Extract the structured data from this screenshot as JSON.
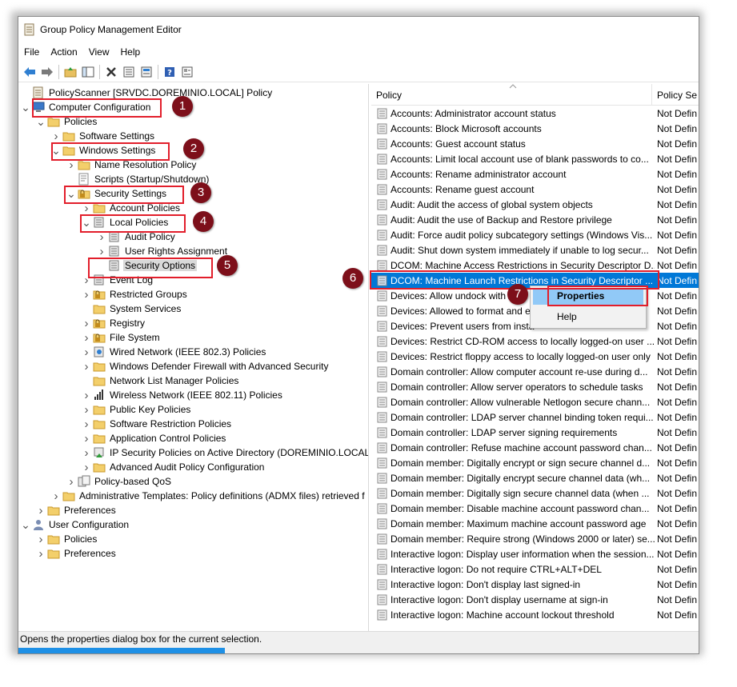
{
  "window": {
    "title": "Group Policy Management Editor"
  },
  "menu": [
    "File",
    "Action",
    "View",
    "Help"
  ],
  "toolbar": [
    "back-arrow-icon",
    "forward-arrow-icon",
    "up-folder-icon",
    "show-hide-tree-icon",
    "delete-icon",
    "properties-icon",
    "export-list-icon",
    "help-icon",
    "view-icon"
  ],
  "tree": [
    {
      "label": "PolicyScanner [SRVDC.DOREMINIO.LOCAL] Policy",
      "depth": 0,
      "arrow": "",
      "icon": "policy-scroll-icon"
    },
    {
      "label": "Computer Configuration",
      "depth": 0,
      "arrow": "down",
      "icon": "computer-icon"
    },
    {
      "label": "Policies",
      "depth": 1,
      "arrow": "down",
      "icon": "folder-icon"
    },
    {
      "label": "Software Settings",
      "depth": 2,
      "arrow": "right",
      "icon": "folder-icon"
    },
    {
      "label": "Windows Settings",
      "depth": 2,
      "arrow": "down",
      "icon": "folder-icon"
    },
    {
      "label": "Name Resolution Policy",
      "depth": 3,
      "arrow": "right",
      "icon": "folder-icon"
    },
    {
      "label": "Scripts (Startup/Shutdown)",
      "depth": 3,
      "arrow": "",
      "icon": "script-icon"
    },
    {
      "label": "Security Settings",
      "depth": 3,
      "arrow": "down",
      "icon": "lock-folder-icon"
    },
    {
      "label": "Account Policies",
      "depth": 4,
      "arrow": "right",
      "icon": "folder-icon"
    },
    {
      "label": "Local Policies",
      "depth": 4,
      "arrow": "down",
      "icon": "policy-book-icon"
    },
    {
      "label": "Audit Policy",
      "depth": 5,
      "arrow": "right",
      "icon": "policy-book-icon"
    },
    {
      "label": "User Rights Assignment",
      "depth": 5,
      "arrow": "right",
      "icon": "policy-book-icon"
    },
    {
      "label": "Security Options",
      "depth": 5,
      "arrow": "",
      "icon": "policy-book-icon",
      "selected": true
    },
    {
      "label": "Event Log",
      "depth": 4,
      "arrow": "right",
      "icon": "policy-book-icon"
    },
    {
      "label": "Restricted Groups",
      "depth": 4,
      "arrow": "right",
      "icon": "lock-folder-icon"
    },
    {
      "label": "System Services",
      "depth": 4,
      "arrow": "",
      "icon": "folder-icon"
    },
    {
      "label": "Registry",
      "depth": 4,
      "arrow": "right",
      "icon": "lock-folder-icon"
    },
    {
      "label": "File System",
      "depth": 4,
      "arrow": "right",
      "icon": "lock-folder-icon"
    },
    {
      "label": "Wired Network (IEEE 802.3) Policies",
      "depth": 4,
      "arrow": "right",
      "icon": "network-icon"
    },
    {
      "label": "Windows Defender Firewall with Advanced Security",
      "depth": 4,
      "arrow": "right",
      "icon": "folder-icon"
    },
    {
      "label": "Network List Manager Policies",
      "depth": 4,
      "arrow": "",
      "icon": "folder-icon"
    },
    {
      "label": "Wireless Network (IEEE 802.11) Policies",
      "depth": 4,
      "arrow": "right",
      "icon": "signal-icon"
    },
    {
      "label": "Public Key Policies",
      "depth": 4,
      "arrow": "right",
      "icon": "folder-icon"
    },
    {
      "label": "Software Restriction Policies",
      "depth": 4,
      "arrow": "right",
      "icon": "folder-icon"
    },
    {
      "label": "Application Control Policies",
      "depth": 4,
      "arrow": "right",
      "icon": "folder-icon"
    },
    {
      "label": "IP Security Policies on Active Directory (DOREMINIO.LOCAL)",
      "depth": 4,
      "arrow": "right",
      "icon": "ipsec-icon"
    },
    {
      "label": "Advanced Audit Policy Configuration",
      "depth": 4,
      "arrow": "right",
      "icon": "folder-icon"
    },
    {
      "label": "Policy-based QoS",
      "depth": 3,
      "arrow": "right",
      "icon": "qos-icon"
    },
    {
      "label": "Administrative Templates: Policy definitions (ADMX files) retrieved f",
      "depth": 2,
      "arrow": "right",
      "icon": "folder-icon"
    },
    {
      "label": "Preferences",
      "depth": 1,
      "arrow": "right",
      "icon": "folder-icon"
    },
    {
      "label": "User Configuration",
      "depth": 0,
      "arrow": "down",
      "icon": "user-icon"
    },
    {
      "label": "Policies",
      "depth": 1,
      "arrow": "right",
      "icon": "folder-icon"
    },
    {
      "label": "Preferences",
      "depth": 1,
      "arrow": "right",
      "icon": "folder-icon"
    }
  ],
  "list": {
    "columns": [
      "Policy",
      "Policy Se"
    ],
    "rows": [
      {
        "name": "Accounts: Administrator account status",
        "setting": "Not Defin"
      },
      {
        "name": "Accounts: Block Microsoft accounts",
        "setting": "Not Defin"
      },
      {
        "name": "Accounts: Guest account status",
        "setting": "Not Defin"
      },
      {
        "name": "Accounts: Limit local account use of blank passwords to co...",
        "setting": "Not Defin"
      },
      {
        "name": "Accounts: Rename administrator account",
        "setting": "Not Defin"
      },
      {
        "name": "Accounts: Rename guest account",
        "setting": "Not Defin"
      },
      {
        "name": "Audit: Audit the access of global system objects",
        "setting": "Not Defin"
      },
      {
        "name": "Audit: Audit the use of Backup and Restore privilege",
        "setting": "Not Defin"
      },
      {
        "name": "Audit: Force audit policy subcategory settings (Windows Vis...",
        "setting": "Not Defin"
      },
      {
        "name": "Audit: Shut down system immediately if unable to log secur...",
        "setting": "Not Defin"
      },
      {
        "name": "DCOM: Machine Access Restrictions in Security Descriptor D...",
        "setting": "Not Defin"
      },
      {
        "name": "DCOM: Machine Launch Restrictions in Security Descriptor ...",
        "setting": "Not Defin",
        "selected": true
      },
      {
        "name": "Devices: Allow undock with",
        "setting": "Not Defin"
      },
      {
        "name": "Devices: Allowed to format and e",
        "setting": "Not Defin"
      },
      {
        "name": "Devices: Prevent users from insta",
        "setting": "Not Defin"
      },
      {
        "name": "Devices: Restrict CD-ROM access to locally logged-on user ...",
        "setting": "Not Defin"
      },
      {
        "name": "Devices: Restrict floppy access to locally logged-on user only",
        "setting": "Not Defin"
      },
      {
        "name": "Domain controller: Allow computer account re-use during d...",
        "setting": "Not Defin"
      },
      {
        "name": "Domain controller: Allow server operators to schedule tasks",
        "setting": "Not Defin"
      },
      {
        "name": "Domain controller: Allow vulnerable Netlogon secure chann...",
        "setting": "Not Defin"
      },
      {
        "name": "Domain controller: LDAP server channel binding token requi...",
        "setting": "Not Defin"
      },
      {
        "name": "Domain controller: LDAP server signing requirements",
        "setting": "Not Defin"
      },
      {
        "name": "Domain controller: Refuse machine account password chan...",
        "setting": "Not Defin"
      },
      {
        "name": "Domain member: Digitally encrypt or sign secure channel d...",
        "setting": "Not Defin"
      },
      {
        "name": "Domain member: Digitally encrypt secure channel data (wh...",
        "setting": "Not Defin"
      },
      {
        "name": "Domain member: Digitally sign secure channel data (when ...",
        "setting": "Not Defin"
      },
      {
        "name": "Domain member: Disable machine account password chan...",
        "setting": "Not Defin"
      },
      {
        "name": "Domain member: Maximum machine account password age",
        "setting": "Not Defin"
      },
      {
        "name": "Domain member: Require strong (Windows 2000 or later) se...",
        "setting": "Not Defin"
      },
      {
        "name": "Interactive logon: Display user information when the session...",
        "setting": "Not Defin"
      },
      {
        "name": "Interactive logon: Do not require CTRL+ALT+DEL",
        "setting": "Not Defin"
      },
      {
        "name": "Interactive logon: Don't display last signed-in",
        "setting": "Not Defin"
      },
      {
        "name": "Interactive logon: Don't display username at sign-in",
        "setting": "Not Defin"
      },
      {
        "name": "Interactive logon: Machine account lockout threshold",
        "setting": "Not Defin"
      }
    ]
  },
  "context_menu": {
    "items": [
      "Properties",
      "Help"
    ]
  },
  "status": {
    "text": "Opens the properties dialog box for the current selection."
  },
  "callouts": [
    "1",
    "2",
    "3",
    "4",
    "5",
    "6",
    "7"
  ],
  "colors": {
    "selection": "#0078d7",
    "annotation_red": "#e21e2b",
    "callout_fill": "#7d0f1a",
    "menu_highlight": "#91c9f7"
  }
}
